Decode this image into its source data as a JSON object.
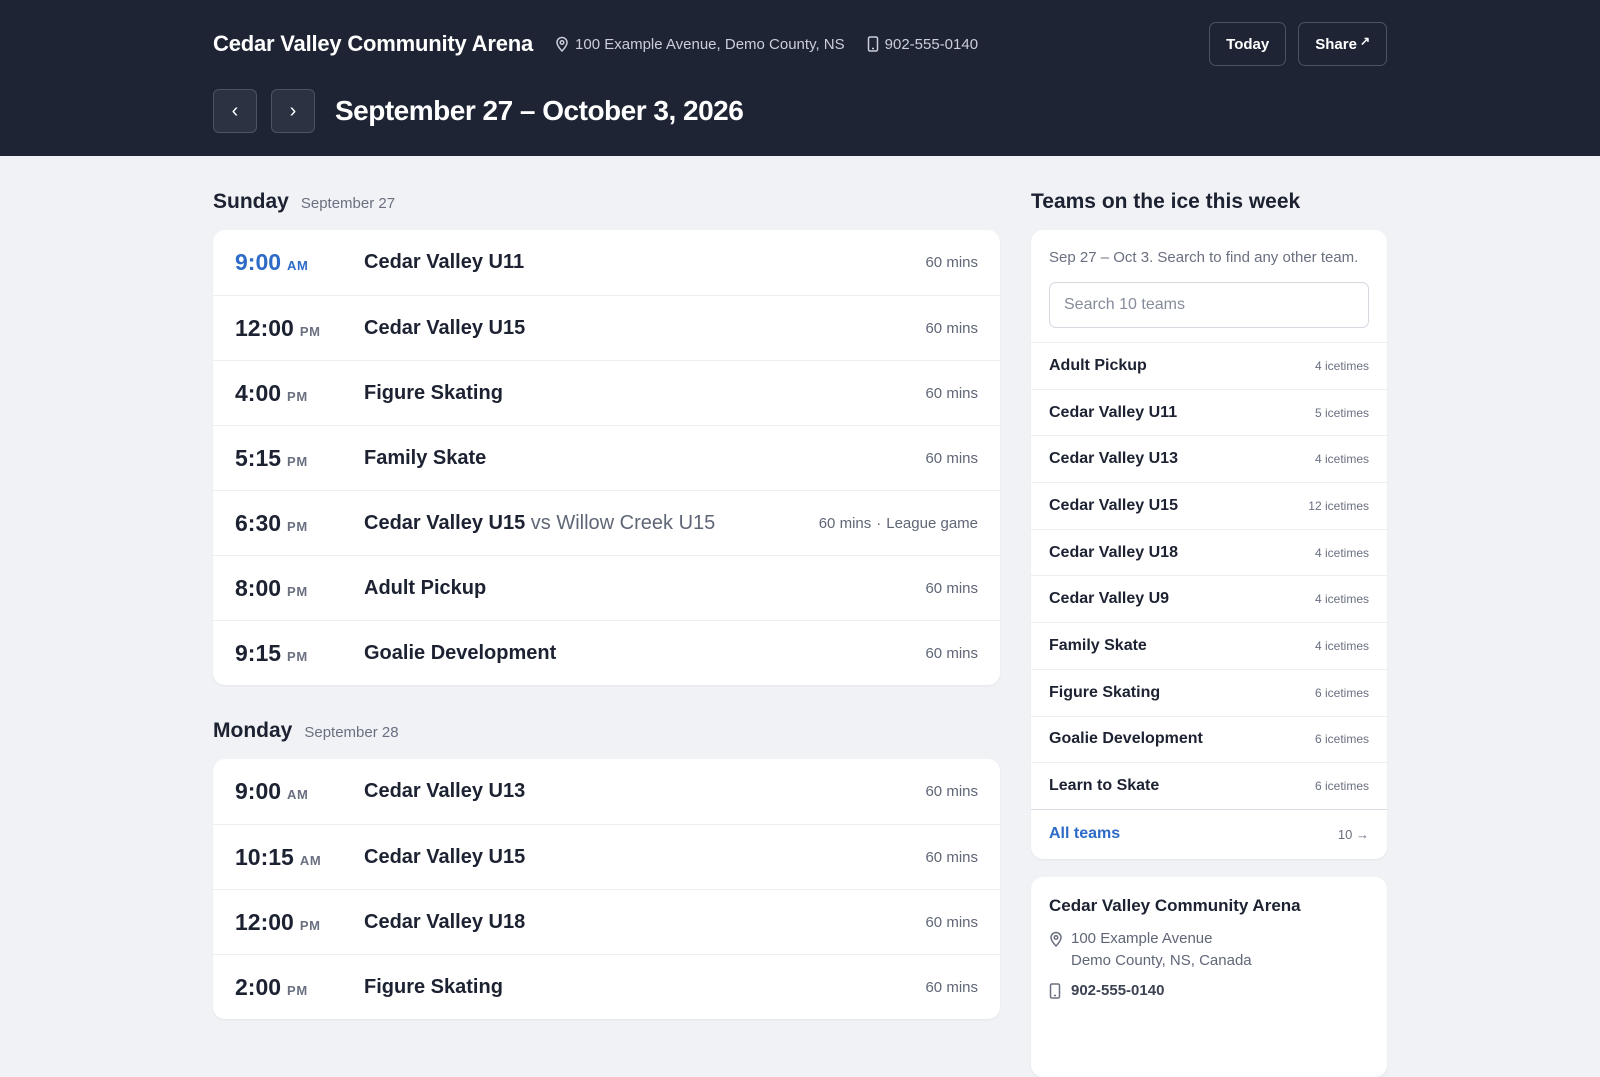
{
  "header": {
    "arena_name": "Cedar Valley Community Arena",
    "address": "100 Example Avenue, Demo County, NS",
    "phone": "902-555-0140",
    "today_label": "Today",
    "share_label": "Share",
    "share_icon": "↗",
    "prev_icon": "‹",
    "next_icon": "›",
    "week_title": "September 27 – October 3, 2026"
  },
  "days": [
    {
      "name": "Sunday",
      "date": "September 27",
      "events": [
        {
          "time": "9:00",
          "ampm": "AM",
          "team": "Cedar Valley U11",
          "opponent": "",
          "duration": "60 mins",
          "note": "",
          "highlight": true
        },
        {
          "time": "12:00",
          "ampm": "PM",
          "team": "Cedar Valley U15",
          "opponent": "",
          "duration": "60 mins",
          "note": ""
        },
        {
          "time": "4:00",
          "ampm": "PM",
          "team": "Figure Skating",
          "opponent": "",
          "duration": "60 mins",
          "note": ""
        },
        {
          "time": "5:15",
          "ampm": "PM",
          "team": "Family Skate",
          "opponent": "",
          "duration": "60 mins",
          "note": ""
        },
        {
          "time": "6:30",
          "ampm": "PM",
          "team": "Cedar Valley U15",
          "opponent": "vs Willow Creek U15",
          "duration": "60 mins",
          "note": "League game"
        },
        {
          "time": "8:00",
          "ampm": "PM",
          "team": "Adult Pickup",
          "opponent": "",
          "duration": "60 mins",
          "note": ""
        },
        {
          "time": "9:15",
          "ampm": "PM",
          "team": "Goalie Development",
          "opponent": "",
          "duration": "60 mins",
          "note": ""
        }
      ]
    },
    {
      "name": "Monday",
      "date": "September 28",
      "events": [
        {
          "time": "9:00",
          "ampm": "AM",
          "team": "Cedar Valley U13",
          "opponent": "",
          "duration": "60 mins",
          "note": ""
        },
        {
          "time": "10:15",
          "ampm": "AM",
          "team": "Cedar Valley U15",
          "opponent": "",
          "duration": "60 mins",
          "note": ""
        },
        {
          "time": "12:00",
          "ampm": "PM",
          "team": "Cedar Valley U18",
          "opponent": "",
          "duration": "60 mins",
          "note": ""
        },
        {
          "time": "2:00",
          "ampm": "PM",
          "team": "Figure Skating",
          "opponent": "",
          "duration": "60 mins",
          "note": ""
        }
      ]
    }
  ],
  "sidebar": {
    "title": "Teams on the ice this week",
    "note": "Sep 27 – Oct 3. Search to find any other team.",
    "search_placeholder": "Search 10 teams",
    "teams": [
      {
        "name": "Adult Pickup",
        "count": "4 icetimes"
      },
      {
        "name": "Cedar Valley U11",
        "count": "5 icetimes"
      },
      {
        "name": "Cedar Valley U13",
        "count": "4 icetimes"
      },
      {
        "name": "Cedar Valley U15",
        "count": "12 icetimes"
      },
      {
        "name": "Cedar Valley U18",
        "count": "4 icetimes"
      },
      {
        "name": "Cedar Valley U9",
        "count": "4 icetimes"
      },
      {
        "name": "Family Skate",
        "count": "4 icetimes"
      },
      {
        "name": "Figure Skating",
        "count": "6 icetimes"
      },
      {
        "name": "Goalie Development",
        "count": "6 icetimes"
      },
      {
        "name": "Learn to Skate",
        "count": "6 icetimes"
      }
    ],
    "all_teams_label": "All teams",
    "all_teams_count": "10 →"
  },
  "venue": {
    "name": "Cedar Valley Community Arena",
    "address_line1": "100 Example Avenue",
    "address_line2": "Demo County, NS, Canada",
    "phone": "902-555-0140"
  },
  "colors": {
    "header_bg": "#1e2433",
    "accent": "#2e6bc7",
    "page_bg": "#f1f2f5"
  }
}
